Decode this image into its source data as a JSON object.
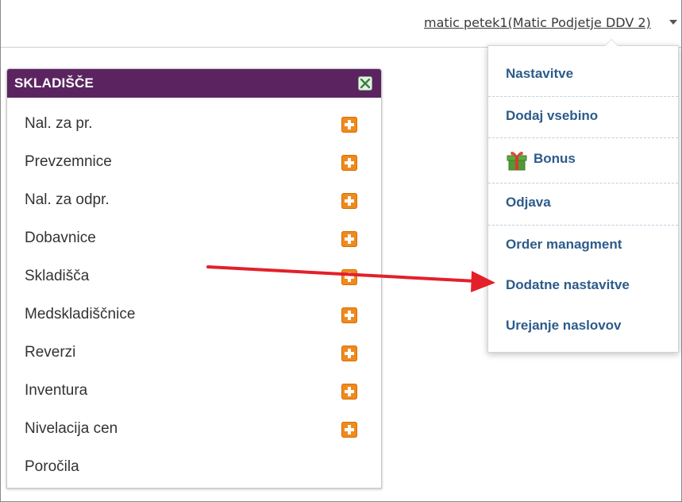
{
  "header": {
    "user_label": "matic petek1(Matic Podjetje DDV 2)"
  },
  "widget": {
    "title": "SKLADIŠČE",
    "items": [
      {
        "label": "Nal. za pr.",
        "has_add": true
      },
      {
        "label": "Prevzemnice",
        "has_add": true
      },
      {
        "label": "Nal. za odpr.",
        "has_add": true
      },
      {
        "label": "Dobavnice",
        "has_add": true
      },
      {
        "label": "Skladišča",
        "has_add": true
      },
      {
        "label": "Medskladiščnice",
        "has_add": true
      },
      {
        "label": "Reverzi",
        "has_add": true
      },
      {
        "label": "Inventura",
        "has_add": true
      },
      {
        "label": "Nivelacija cen",
        "has_add": true
      },
      {
        "label": "Poročila",
        "has_add": false
      }
    ]
  },
  "menu": {
    "items": [
      {
        "label": "Nastavitve"
      },
      {
        "label": "Dodaj vsebino"
      },
      {
        "label": "Bonus",
        "icon": "gift-icon"
      },
      {
        "label": "Odjava"
      },
      {
        "label": "Order managment"
      },
      {
        "label": "Dodatne nastavitve"
      },
      {
        "label": "Urejanje naslovov"
      }
    ]
  },
  "colors": {
    "header_purple": "#5b2460",
    "menu_link": "#2c5b8a",
    "add_icon": "#f08a1c",
    "annotation_arrow": "#e3202a"
  }
}
